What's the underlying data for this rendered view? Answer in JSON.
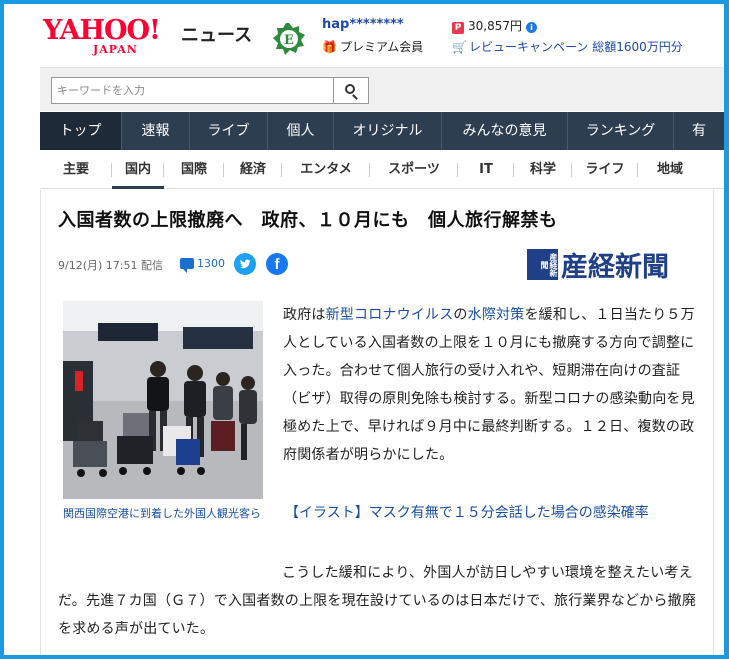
{
  "header": {
    "logo_text": "YAHOO!",
    "logo_sub": "JAPAN",
    "section_label": "ニュース",
    "username": "hap********",
    "membership": "プレミアム会員",
    "points": "30,857円",
    "campaign": "レビューキャンペーン",
    "campaign_extra": "総額1600万円分"
  },
  "search": {
    "placeholder": "キーワードを入力"
  },
  "main_nav": [
    "トップ",
    "速報",
    "ライブ",
    "個人",
    "オリジナル",
    "みんなの意見",
    "ランキング",
    "有"
  ],
  "sub_nav": [
    "主要",
    "国内",
    "国際",
    "経済",
    "エンタメ",
    "スポーツ",
    "IT",
    "科学",
    "ライフ",
    "地域"
  ],
  "article": {
    "title": "入国者数の上限撤廃へ　政府、１０月にも　個人旅行解禁も",
    "datetime": "9/12(月) 17:51 配信",
    "comment_count": "1300",
    "publisher_seal": "産経新聞",
    "publisher_name": "産経新聞",
    "caption": "関西国際空港に到着した外国人観光客ら",
    "p1_a": "政府は",
    "p1_link1": "新型コロナウイルス",
    "p1_b": "の",
    "p1_link2": "水際対策",
    "p1_c": "を緩和し、１日当たり５万人としている入国者数の上限を１０月にも撤廃する方向で調整に入った。合わせて個人旅行の受け入れや、短期滞在向けの査証（ビザ）取得の原則免除も検討する。新型コロナの感染動向を見極めた上で、早ければ９月中に最終判断する。１２日、複数の政府関係者が明らかにした。",
    "related_link": "【イラスト】マスク有無で１５分会話した場合の感染確率",
    "p2": "こうした緩和により、外国人が訪日しやすい環境を整えたい考えだ。先進７カ国（Ｇ７）で入国者数の上限を現在設けているのは日本だけで、旅行業界などから撤廃を求める声が出ていた。"
  },
  "colors": {
    "brand_red": "#ff0033",
    "nav_bg": "#2d3e50",
    "link_blue": "#1a4fa0",
    "frame_blue": "#1a9ae0"
  }
}
